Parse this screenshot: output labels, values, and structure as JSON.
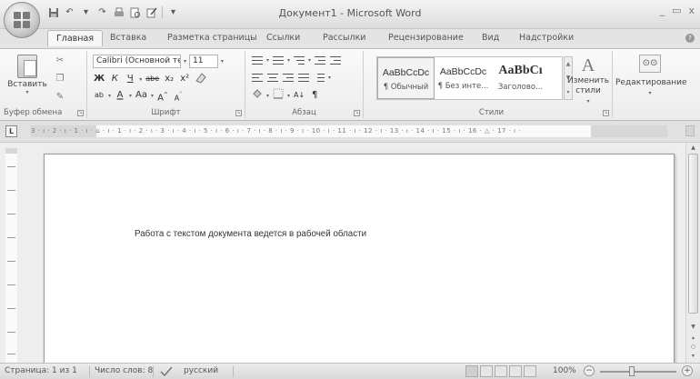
{
  "window": {
    "title": "Документ1 - Microsoft Word",
    "controls": [
      "_",
      "▭",
      "x"
    ]
  },
  "quick_access": {
    "icons": [
      "save-icon",
      "undo-icon",
      "redo-icon",
      "print-icon",
      "print-preview-icon",
      "customize-icon"
    ]
  },
  "tabs": [
    {
      "label": "Главная",
      "active": true
    },
    {
      "label": "Вставка"
    },
    {
      "label": "Разметка страницы"
    },
    {
      "label": "Ссылки"
    },
    {
      "label": "Рассылки"
    },
    {
      "label": "Рецензирование"
    },
    {
      "label": "Вид"
    },
    {
      "label": "Надстройки"
    }
  ],
  "ribbon": {
    "clipboard": {
      "paste_label": "Вставить",
      "group_label": "Буфер обмена"
    },
    "font": {
      "font_name": "Calibri (Основной те",
      "font_size": "11",
      "bold": "Ж",
      "italic": "К",
      "underline": "Ч",
      "strike": "abe",
      "subscript": "x₂",
      "superscript": "x²",
      "font_color": "A",
      "change_case": "Aa",
      "grow": "A",
      "shrink": "A",
      "group_label": "Шрифт"
    },
    "paragraph": {
      "group_label": "Абзац",
      "pilcrow": "¶"
    },
    "styles": {
      "items": [
        {
          "sample": "AaBbCcDc",
          "name": "¶ Обычный"
        },
        {
          "sample": "AaBbCcDc",
          "name": "¶ Без инте..."
        },
        {
          "sample": "AaBbCı",
          "name": "Заголово..."
        }
      ],
      "change_styles": "Изменить стили",
      "group_label": "Стили"
    },
    "editing": {
      "label": "Редактирование"
    }
  },
  "ruler": {
    "tab_selector": "L",
    "text": "3 · ı · 2 · ı · 1 · ı · ⌂ · ı · 1 · ı · 2 · ı · 3 · ı · 4 · ı · 5 · ı · 6 · ı · 7 · ı · 8 · ı · 9 · ı · 10 · ı · 11 · ı · 12 · ı · 13 · ı · 14 · ı · 15 · ı · 16 · △ · 17 · ı ·"
  },
  "document": {
    "text": "Работа с текстом документа ведется в рабочей области"
  },
  "status": {
    "page": "Страница: 1 из 1",
    "words": "Число слов: 8",
    "language": "русский",
    "zoom": "100%"
  }
}
